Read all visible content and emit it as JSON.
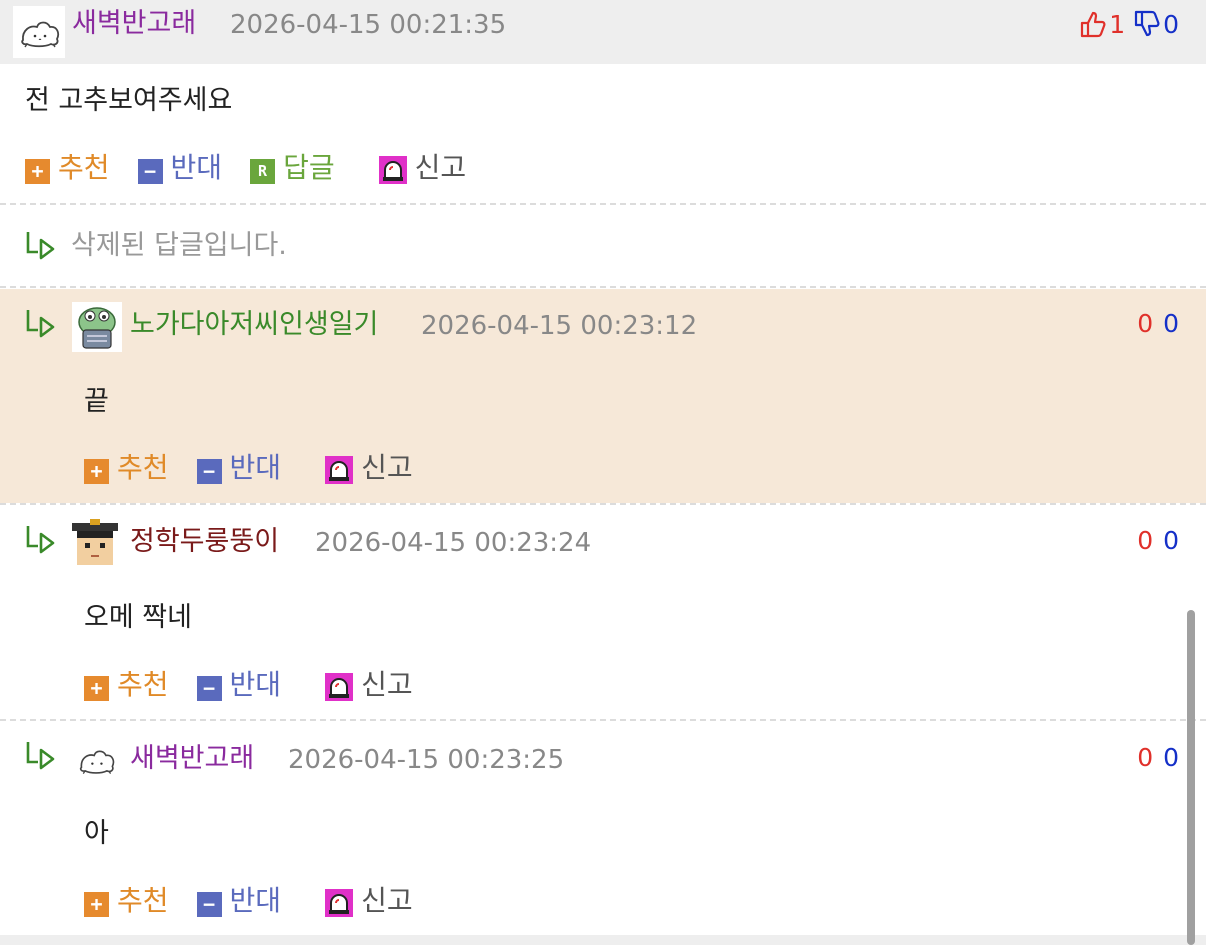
{
  "main_comment": {
    "nickname": "새벽반고래",
    "date": "2026-04-15 00:21:35",
    "up": "1",
    "down": "0",
    "text": "전 고추보여주세요",
    "actions": {
      "recommend": "추천",
      "oppose": "반대",
      "reply": "답글",
      "report": "신고"
    },
    "colors": {
      "nickname": "#8a2a9e"
    }
  },
  "deleted_reply": {
    "text": "삭제된 답글입니다."
  },
  "replies": [
    {
      "nickname": "노가다아저씨인생일기",
      "date": "2026-04-15 00:23:12",
      "up": "0",
      "down": "0",
      "text": "끝",
      "actions": {
        "recommend": "추천",
        "oppose": "반대",
        "report": "신고"
      },
      "highlighted": true,
      "colors": {
        "nickname": "#3a8a2a"
      },
      "avatar_icon": "frog-avatar-icon"
    },
    {
      "nickname": "정학두룽뚱이",
      "date": "2026-04-15 00:23:24",
      "up": "0",
      "down": "0",
      "text": "오메 짝네",
      "actions": {
        "recommend": "추천",
        "oppose": "반대",
        "report": "신고"
      },
      "colors": {
        "nickname": "#7a1a1a"
      },
      "avatar_icon": "graduate-avatar-icon"
    },
    {
      "nickname": "새벽반고래",
      "date": "2026-04-15 00:23:25",
      "up": "0",
      "down": "0",
      "text": "아",
      "actions": {
        "recommend": "추천",
        "oppose": "반대",
        "report": "신고"
      },
      "colors": {
        "nickname": "#8a2a9e"
      },
      "avatar_icon": "whale-avatar-icon"
    }
  ],
  "icons": {
    "recommend": "plus-icon",
    "oppose": "minus-icon",
    "reply": "reply-r-icon",
    "report": "siren-icon",
    "thumbs_up": "thumbs-up-icon",
    "thumbs_down": "thumbs-down-icon",
    "reply_arrow": "reply-arrow-icon"
  }
}
